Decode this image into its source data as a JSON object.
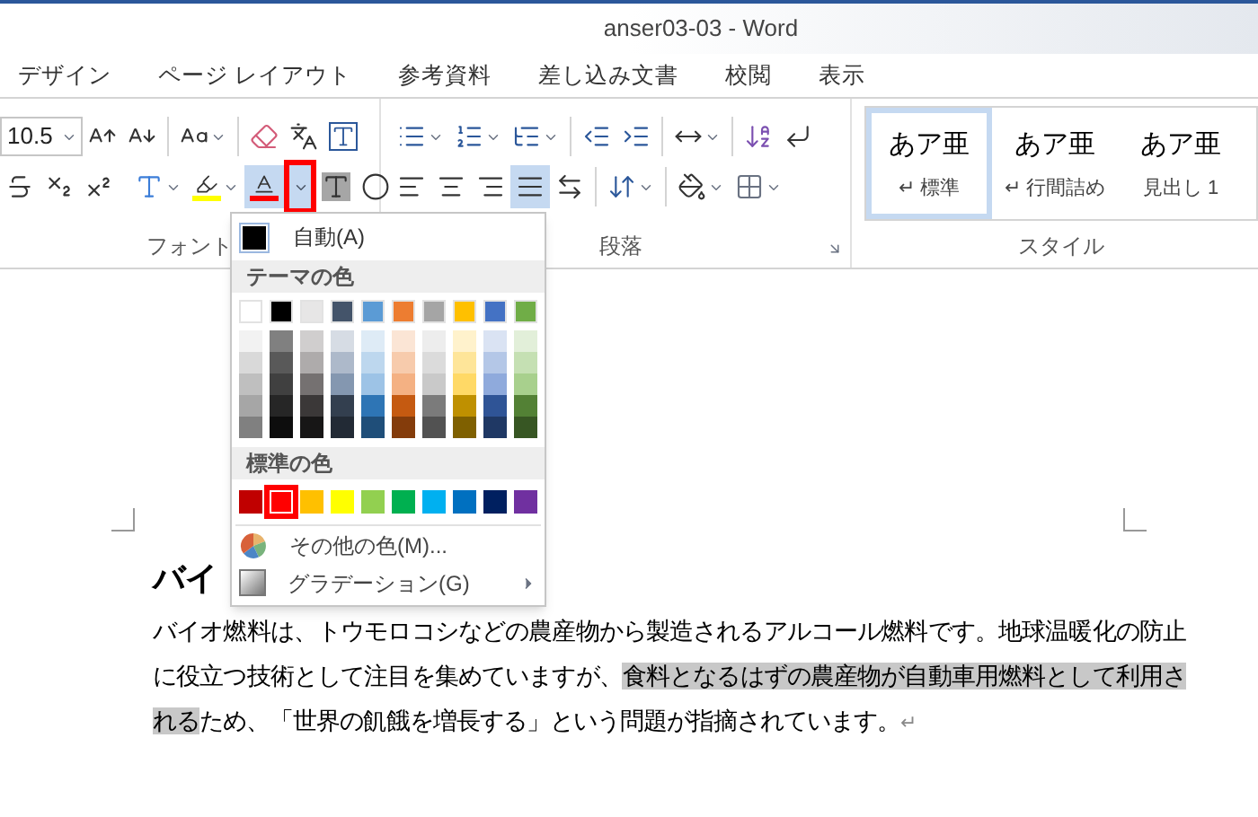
{
  "window": {
    "title": "anser03-03 - Word"
  },
  "tabs": [
    {
      "label": "デザイン",
      "selected": false
    },
    {
      "label": "ページ レイアウト",
      "selected": false
    },
    {
      "label": "参考資料",
      "selected": false
    },
    {
      "label": "差し込み文書",
      "selected": false
    },
    {
      "label": "校閲",
      "selected": false
    },
    {
      "label": "表示",
      "selected": false
    }
  ],
  "ribbon": {
    "font_size": "10.5",
    "font_color_selected": true,
    "alignment": [
      {
        "kind": "left",
        "selected": false
      },
      {
        "kind": "center",
        "selected": false
      },
      {
        "kind": "right",
        "selected": false
      },
      {
        "kind": "justify",
        "selected": true
      },
      {
        "kind": "distributed",
        "selected": false
      }
    ],
    "groups": [
      {
        "label": "フォント"
      },
      {
        "label": "段落"
      },
      {
        "label": "スタイル"
      }
    ],
    "styles": [
      {
        "preview": "あア亜",
        "label": "標準",
        "paragraph_mark": true,
        "selected": true
      },
      {
        "preview": "あア亜",
        "label": "行間詰め",
        "paragraph_mark": true,
        "selected": false
      },
      {
        "preview": "あア亜",
        "label": "見出し 1",
        "paragraph_mark": false,
        "selected": false
      }
    ]
  },
  "color_menu": {
    "automatic": "自動(A)",
    "theme_header": "テーマの色",
    "theme_colors": [
      {
        "color": "#ffffff",
        "shades": [
          {
            "color": "#f2f2f2"
          },
          {
            "color": "#d9d9d9"
          },
          {
            "color": "#bfbfbf"
          },
          {
            "color": "#a6a6a6"
          },
          {
            "color": "#808080"
          }
        ]
      },
      {
        "color": "#000000",
        "shades": [
          {
            "color": "#808080"
          },
          {
            "color": "#595959"
          },
          {
            "color": "#404040"
          },
          {
            "color": "#262626"
          },
          {
            "color": "#0d0d0d"
          }
        ]
      },
      {
        "color": "#e7e6e6",
        "shades": [
          {
            "color": "#d0cece"
          },
          {
            "color": "#aeabab"
          },
          {
            "color": "#757171"
          },
          {
            "color": "#3b3838"
          },
          {
            "color": "#171616"
          }
        ]
      },
      {
        "color": "#44546a",
        "shades": [
          {
            "color": "#d6dce4"
          },
          {
            "color": "#adb9ca"
          },
          {
            "color": "#8497b0"
          },
          {
            "color": "#333f4f"
          },
          {
            "color": "#222a35"
          }
        ]
      },
      {
        "color": "#5b9bd5",
        "shades": [
          {
            "color": "#deebf6"
          },
          {
            "color": "#bdd7ee"
          },
          {
            "color": "#9dc3e6"
          },
          {
            "color": "#2e75b5"
          },
          {
            "color": "#1f4e79"
          }
        ]
      },
      {
        "color": "#ed7d31",
        "shades": [
          {
            "color": "#fbe5d5"
          },
          {
            "color": "#f7cbac"
          },
          {
            "color": "#f4b183"
          },
          {
            "color": "#c55a11"
          },
          {
            "color": "#843c0b"
          }
        ]
      },
      {
        "color": "#a5a5a5",
        "shades": [
          {
            "color": "#ededed"
          },
          {
            "color": "#dbdbdb"
          },
          {
            "color": "#c9c9c9"
          },
          {
            "color": "#7b7b7b"
          },
          {
            "color": "#525252"
          }
        ]
      },
      {
        "color": "#ffc000",
        "shades": [
          {
            "color": "#fff2cc"
          },
          {
            "color": "#fee599"
          },
          {
            "color": "#ffd966"
          },
          {
            "color": "#bf9000"
          },
          {
            "color": "#7f6000"
          }
        ]
      },
      {
        "color": "#4472c4",
        "shades": [
          {
            "color": "#dae3f3"
          },
          {
            "color": "#b4c7e7"
          },
          {
            "color": "#8faadc"
          },
          {
            "color": "#2f5496"
          },
          {
            "color": "#1f3864"
          }
        ]
      },
      {
        "color": "#70ad47",
        "shades": [
          {
            "color": "#e2efd9"
          },
          {
            "color": "#c5e0b3"
          },
          {
            "color": "#a8d08d"
          },
          {
            "color": "#538135"
          },
          {
            "color": "#375623"
          }
        ]
      }
    ],
    "standard_header": "標準の色",
    "standard_colors": [
      {
        "color": "#c00000",
        "selected": false
      },
      {
        "color": "#ff0000",
        "selected": true
      },
      {
        "color": "#ffc000",
        "selected": false
      },
      {
        "color": "#ffff00",
        "selected": false
      },
      {
        "color": "#92d050",
        "selected": false
      },
      {
        "color": "#00b050",
        "selected": false
      },
      {
        "color": "#00b0f0",
        "selected": false
      },
      {
        "color": "#0070c0",
        "selected": false
      },
      {
        "color": "#002060",
        "selected": false
      },
      {
        "color": "#7030a0",
        "selected": false
      }
    ],
    "items": [
      {
        "label": "その他の色(M)...",
        "kind": "palette"
      },
      {
        "label": "グラデーション(G)",
        "kind": "submenu"
      }
    ]
  },
  "document": {
    "heading": "バイ",
    "paragraph": [
      {
        "text": "バイオ燃料は、トウモロコシなどの農産物から製造されるアルコール燃料です。地球温暖化の防止に役立つ技術として注目を集めていますが、",
        "highlighted": false
      },
      {
        "text": "食料となるはずの農産物が自動車用燃料として利用される",
        "highlighted": true
      },
      {
        "text": "ため、「世界の飢餓を増長する」という問題が指摘されています。",
        "highlighted": false
      }
    ],
    "end_mark": "↵"
  }
}
